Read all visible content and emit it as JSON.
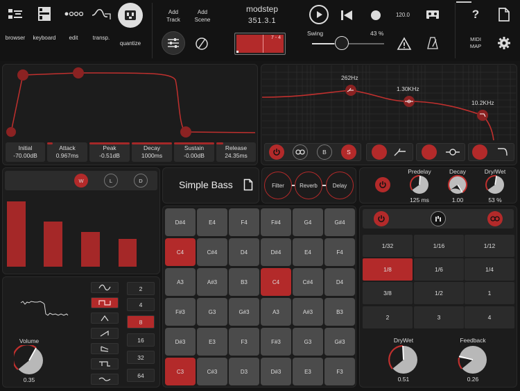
{
  "toolbar": {
    "browser": "browser",
    "keyboard": "keyboard",
    "edit": "edit",
    "transpose": "transp.",
    "quantize": "quantize",
    "add_track": "Add\nTrack",
    "add_scene": "Add\nScene",
    "app_name": "modstep",
    "position": "351.3.1",
    "loop_label": "7 - 4",
    "swing_label": "Swing",
    "swing_value": "43 %",
    "swing_level": 0.43,
    "tempo": "120.0",
    "midi_map": "MIDI\nMAP",
    "help": "?"
  },
  "envelope": {
    "params": [
      {
        "label": "Initial",
        "value": "-70.00dB"
      },
      {
        "label": "Attack",
        "value": "0.967ms"
      },
      {
        "label": "Peak",
        "value": "-0.51dB"
      },
      {
        "label": "Decay",
        "value": "1000ms"
      },
      {
        "label": "Sustain",
        "value": "-0.00dB"
      },
      {
        "label": "Release",
        "value": "24.35ms"
      }
    ]
  },
  "eq": {
    "bands": [
      "262Hz",
      "1.30KHz",
      "10.2KHz"
    ],
    "buttons": {
      "b": "B",
      "s": "S"
    }
  },
  "filter_bank": {
    "buttons": {
      "w": "W",
      "l": "L",
      "d": "D"
    },
    "bar_levels": [
      0.93,
      0.71,
      0.5,
      0.4
    ]
  },
  "instrument": {
    "name": "Simple Bass"
  },
  "fx_chain": {
    "filter": "Filter",
    "reverb": "Reverb",
    "delay": "Delay"
  },
  "reverb": {
    "predelay_label": "Predelay",
    "predelay_value": "125 ms",
    "decay_label": "Decay",
    "decay_value": "1.00",
    "drywet_label": "Dry/Wet",
    "drywet_value": "53 %"
  },
  "pads": [
    [
      "D#4",
      "E4",
      "F4",
      "F#4",
      "G4",
      "G#4"
    ],
    [
      "C4",
      "C#4",
      "D4",
      "D#4",
      "E4",
      "F4"
    ],
    [
      "A3",
      "A#3",
      "B3",
      "C4",
      "C#4",
      "D4"
    ],
    [
      "F#3",
      "G3",
      "G#3",
      "A3",
      "A#3",
      "B3"
    ],
    [
      "D#3",
      "E3",
      "F3",
      "F#3",
      "G3",
      "G#3"
    ],
    [
      "C3",
      "C#3",
      "D3",
      "D#3",
      "E3",
      "F3"
    ]
  ],
  "oscillator": {
    "octaves": [
      "2",
      "4",
      "8",
      "16",
      "32",
      "64"
    ],
    "selected_octave": "8",
    "volume_label": "Volume",
    "volume_value": "0.35"
  },
  "delay": {
    "divisions": [
      [
        "1/32",
        "1/16",
        "1/12"
      ],
      [
        "1/8",
        "1/6",
        "1/4"
      ],
      [
        "3/8",
        "1/2",
        "1"
      ],
      [
        "2",
        "3",
        "4"
      ]
    ],
    "selected": "1/8",
    "drywet_label": "DryWet",
    "drywet_value": "0.51",
    "feedback_label": "Feedback",
    "feedback_value": "0.26"
  },
  "colors": {
    "accent": "#b32a2a",
    "curve": "#c0302e",
    "bg": "#151515"
  }
}
